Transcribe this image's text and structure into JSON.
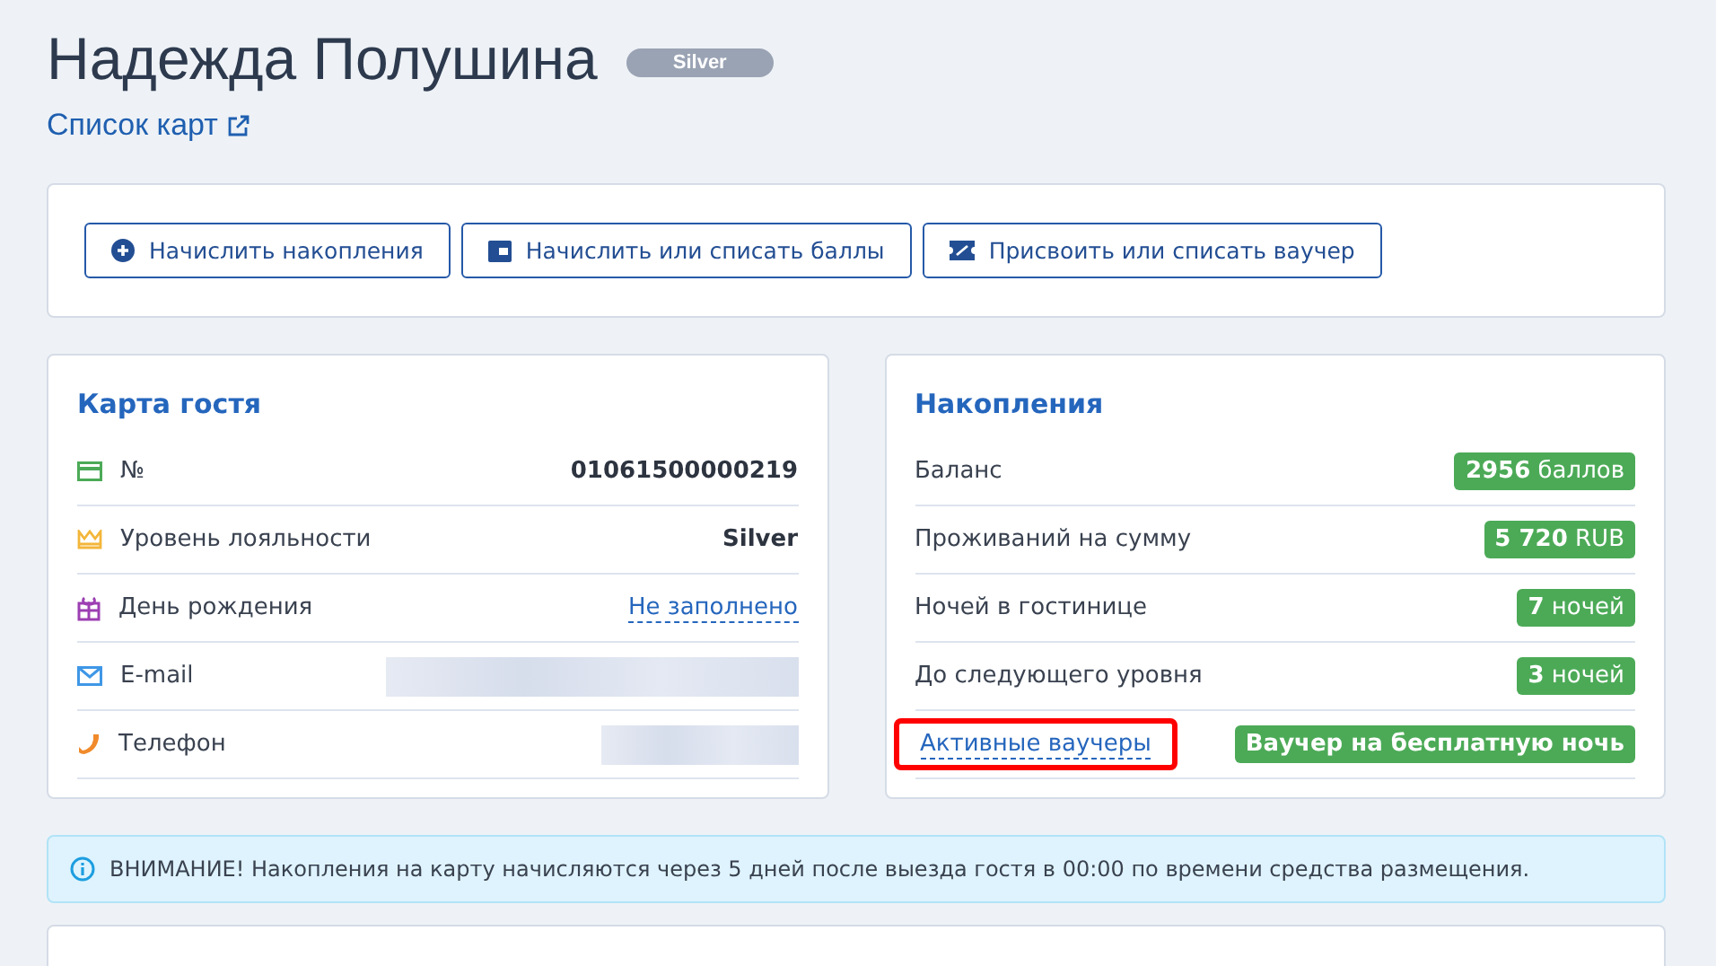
{
  "header": {
    "name": "Надежда Полушина",
    "level_badge": "Silver",
    "cards_link": "Список карт"
  },
  "actions": [
    {
      "kind": "plus",
      "label": "Начислить накопления"
    },
    {
      "kind": "wallet",
      "label": "Начислить или списать баллы"
    },
    {
      "kind": "voucher",
      "label": "Присвоить или списать ваучер"
    }
  ],
  "guest_card": {
    "title": "Карта гостя",
    "rows": [
      {
        "kind": "card",
        "label": "№",
        "value": "01061500000219",
        "link": false,
        "masked": false
      },
      {
        "kind": "crown",
        "label": "Уровень лояльности",
        "value": "Silver",
        "link": false,
        "masked": false
      },
      {
        "kind": "gift",
        "label": "День рождения",
        "value": "Не заполнено",
        "link": true,
        "masked": false
      },
      {
        "kind": "mail",
        "label": "E-mail",
        "masked": true
      },
      {
        "kind": "phone",
        "label": "Телефон",
        "masked": true
      }
    ]
  },
  "savings": {
    "title": "Накопления",
    "rows": [
      {
        "label": "Баланс",
        "badge": "**2956** баллов",
        "link": false,
        "highlighted": false,
        "kind": "mixed"
      },
      {
        "label": "Проживаний на сумму",
        "badge": "**5 720**  RUB",
        "link": false,
        "highlighted": false,
        "kind": "mixed"
      },
      {
        "label": "Ночей в гостинице",
        "badge": "**7** ночей",
        "link": false,
        "highlighted": false,
        "kind": "mixed"
      },
      {
        "label": "До следующего уровня",
        "badge": "**3** ночей",
        "link": false,
        "highlighted": false,
        "kind": "mixed"
      },
      {
        "label": "Активные ваучеры",
        "badge": "Ваучер на бесплатную ночь",
        "link": true,
        "highlighted": true,
        "kind": "bold"
      }
    ]
  },
  "notice": "ВНИМАНИЕ! Накопления на карту начисляются через 5 дней после выезда гостя в 00:00 по времени средства размещения."
}
